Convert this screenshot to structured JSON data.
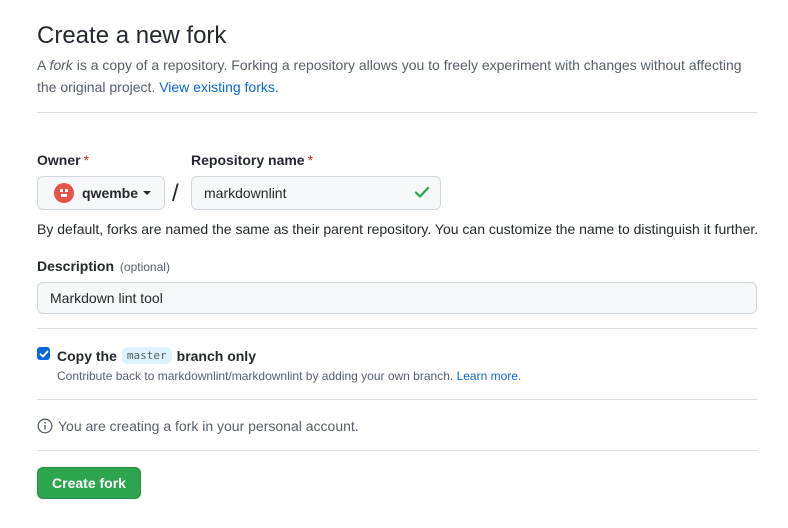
{
  "header": {
    "title": "Create a new fork",
    "intro_a": "A ",
    "intro_em": "fork",
    "intro_b": " is a copy of a repository. Forking a repository allows you to freely experiment with changes without affecting the original project.",
    "intro_link": "View existing forks."
  },
  "form": {
    "owner_label": "Owner",
    "required_mark": "*",
    "owner_value": "qwembe",
    "slash": "/",
    "repo_label": "Repository name",
    "repo_value": "markdownlint",
    "repo_help": "By default, forks are named the same as their parent repository. You can customize the name to distinguish it further.",
    "description_label": "Description",
    "description_optional": "(optional)",
    "description_value": "Markdown lint tool",
    "copy_branch": {
      "checked": true,
      "label_before": "Copy the",
      "branch": "master",
      "label_after": "branch only",
      "note": "Contribute back to markdownlint/markdownlint by adding your own branch.",
      "note_link": "Learn more."
    },
    "info_text": "You are creating a fork in your personal account.",
    "submit_label": "Create fork"
  },
  "colors": {
    "accent": "#0969da",
    "success": "#2da44e",
    "required": "#cf222e",
    "avatar": "#e5534b"
  },
  "icons": [
    "avatar-icon",
    "caret-down-icon",
    "check-icon",
    "checkbox-check-icon",
    "info-icon"
  ]
}
